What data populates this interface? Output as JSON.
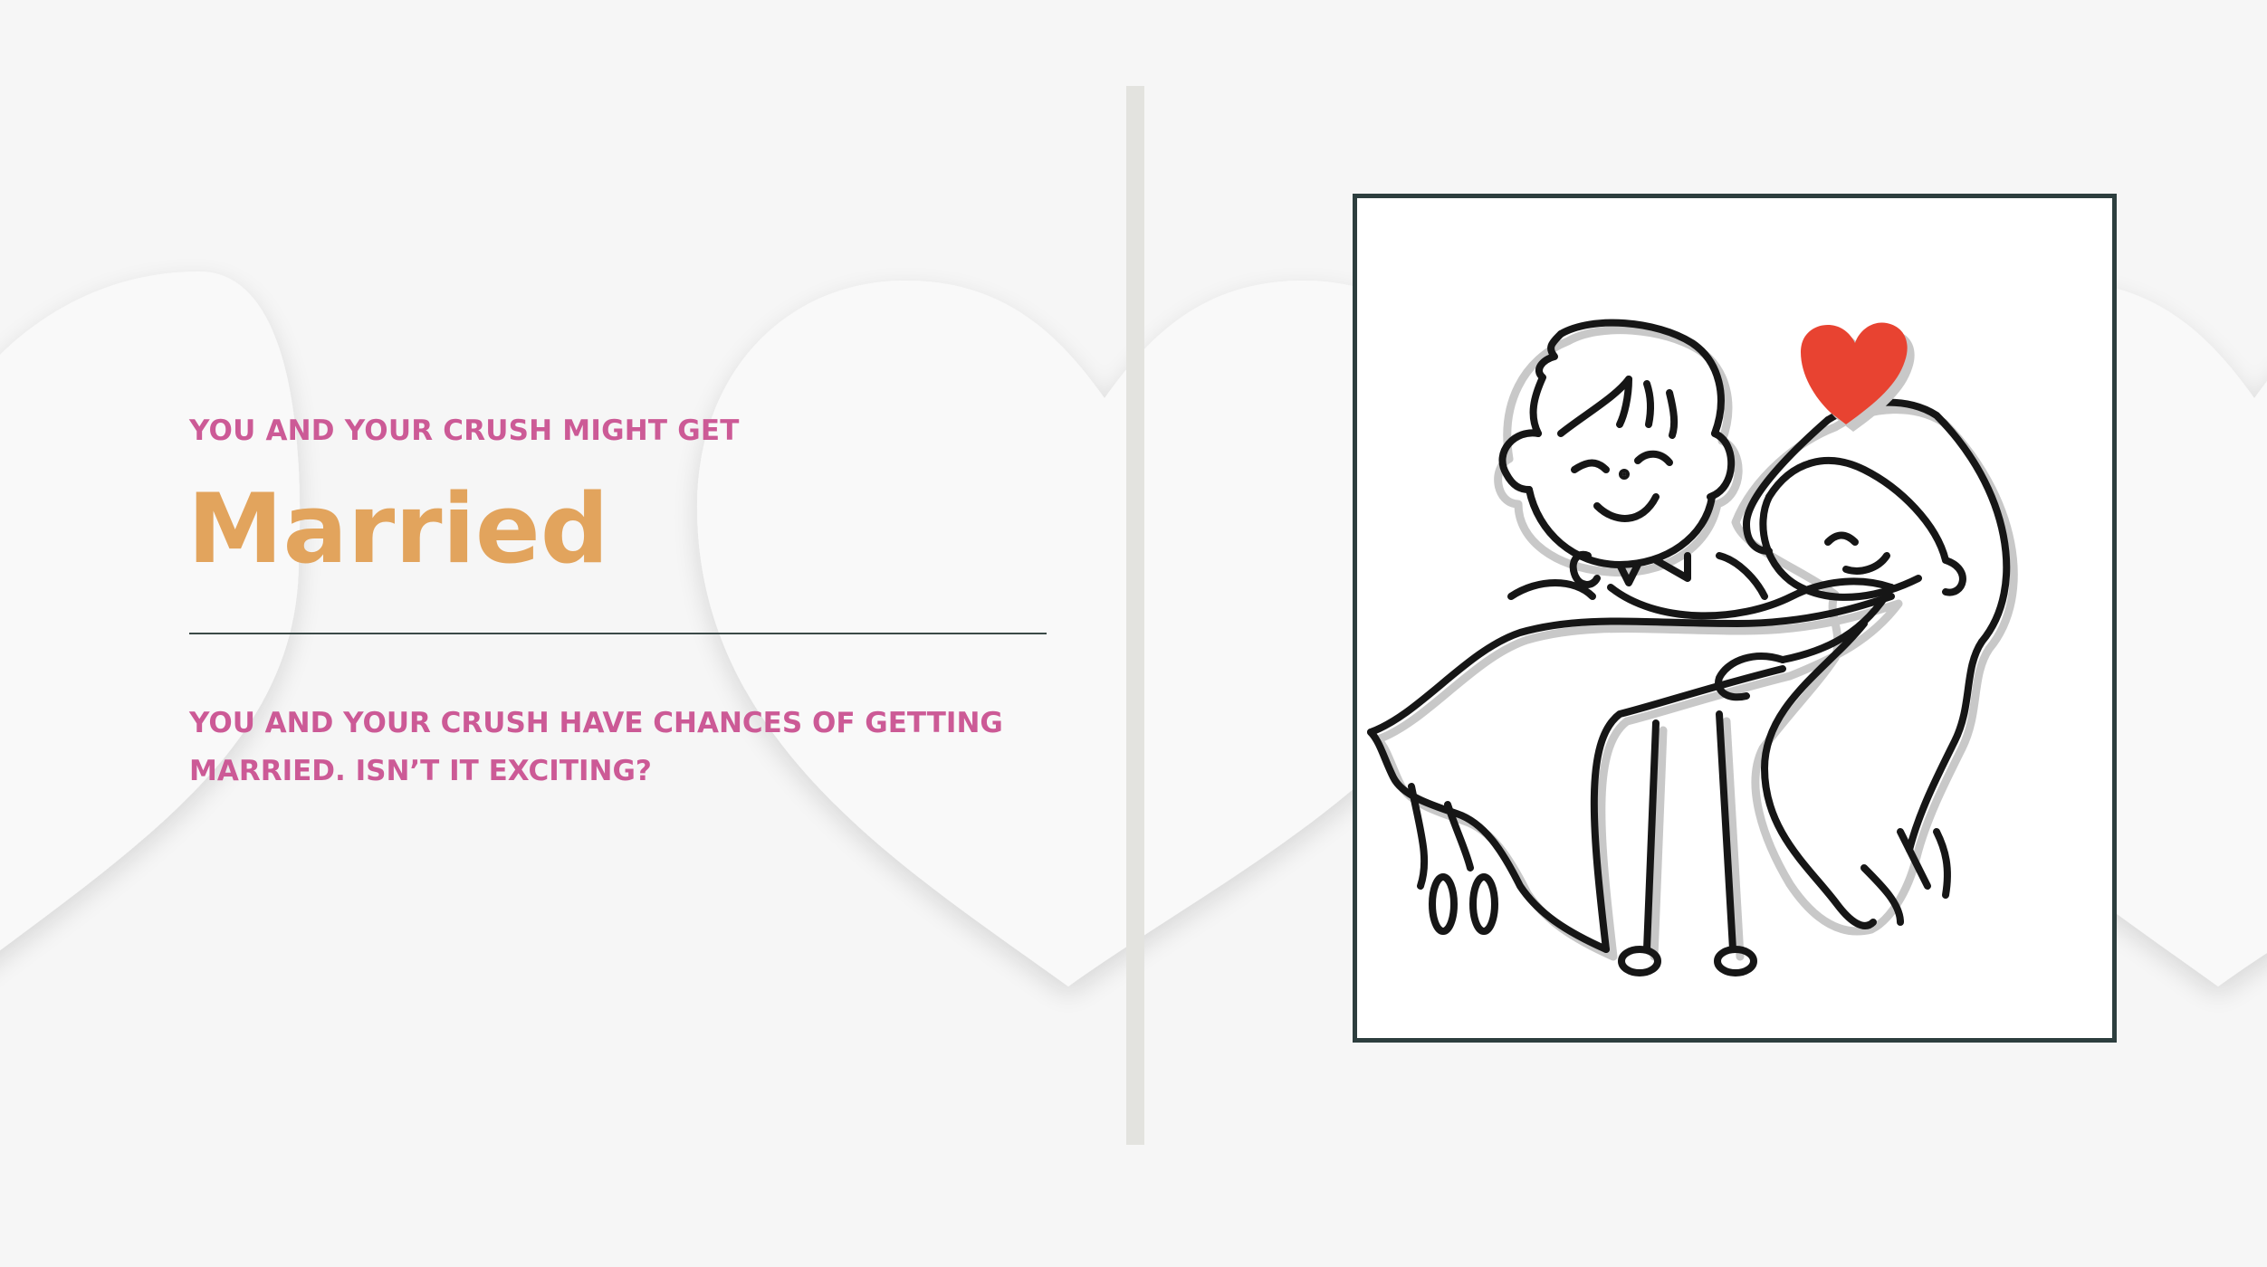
{
  "slide": {
    "eyebrow": "YOU AND YOUR CRUSH MIGHT GET",
    "title": "Married",
    "body": "YOU AND YOUR CRUSH HAVE CHANCES OF GETTING MARRIED. ISN’T IT EXCITING?"
  },
  "illustration": {
    "subject": "couple-carrying-bride",
    "icon": "heart-icon"
  },
  "colors": {
    "background": "#f6f6f6",
    "accent_pink": "#cc5a96",
    "accent_orange": "#e2a45d",
    "frame_border": "#2d3e3e",
    "heart_red": "#e84331"
  }
}
